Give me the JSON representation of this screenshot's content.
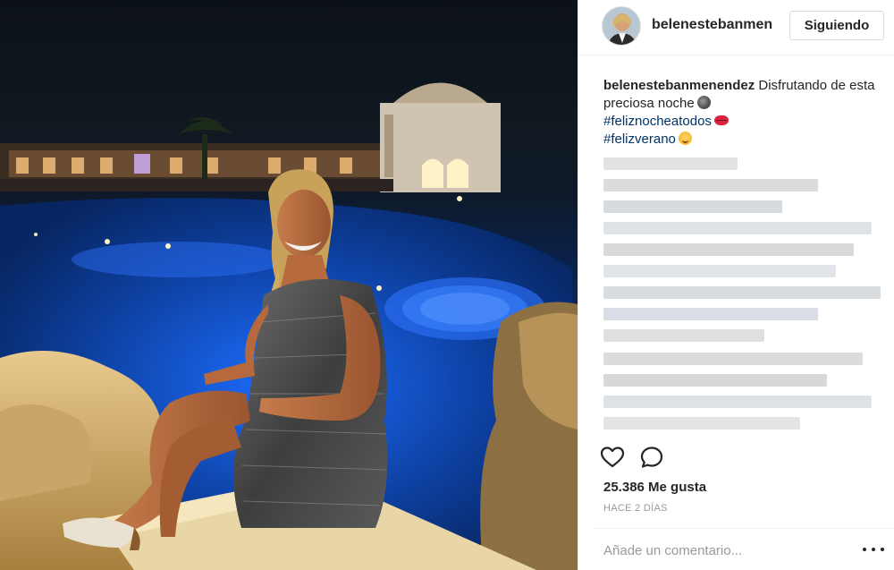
{
  "post": {
    "image_alt": "Mujer sentada junto a una piscina iluminada de noche",
    "username": "belenestebanmenendez",
    "follow_label": "Siguiendo",
    "caption": {
      "user": "belenestebanmenendez",
      "text": "Disfrutando de esta preciosa noche",
      "hashtag_1": "#feliznocheatodos",
      "hashtag_2": "#felizverano"
    },
    "likes_label": "25.386 Me gusta",
    "timestamp": "HACE 2 DÍAS",
    "comment_placeholder": "Añade un comentario..."
  },
  "icons": {
    "like": "heart-outline-icon",
    "comment": "speech-bubble-icon",
    "more": "ellipsis-icon",
    "caption_emojis": [
      "new-moon-emoji",
      "lips-emoji",
      "smiling-face-emoji"
    ]
  },
  "colors": {
    "text": "#262626",
    "hashtag": "#003569",
    "muted": "#999999",
    "border": "#dbdbdb"
  }
}
